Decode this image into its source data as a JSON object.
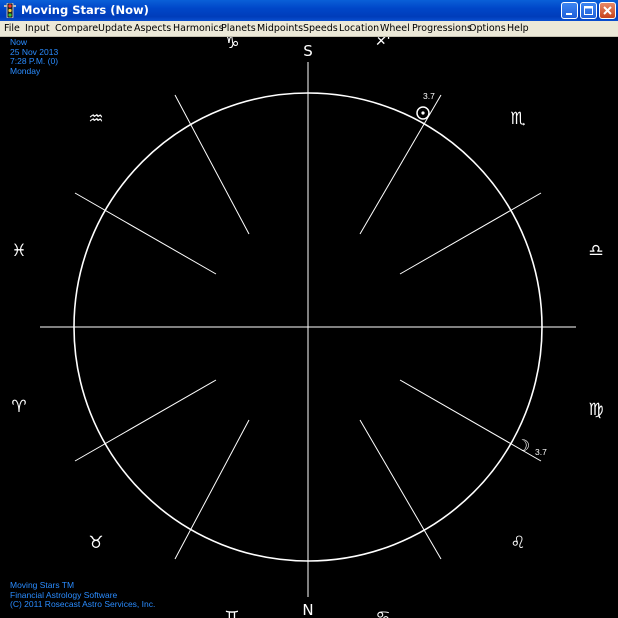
{
  "window": {
    "title": "Moving Stars (Now)",
    "buttons": [
      "minimize",
      "maximize",
      "close"
    ]
  },
  "menu": [
    "File",
    "Input",
    "Compare",
    "Update",
    "Aspects",
    "Harmonics",
    "Planets",
    "Midpoints",
    "Speeds",
    "Location",
    "Wheel",
    "Progressions",
    "Options",
    "Help"
  ],
  "chart_info": {
    "line1": "Now",
    "line2": "25 Nov 2013",
    "line3": "7:28 P.M. (0)",
    "line4": "Monday"
  },
  "footer": {
    "line1": "Moving Stars TM",
    "line2": "Financial Astrology Software",
    "line3": "(C) 2011 Rosecast Astro Services, Inc."
  },
  "wheel": {
    "south_label": "S",
    "north_label": "N",
    "signs": {
      "capricorn": "♑",
      "sagittarius": "♐",
      "aquarius": "♒",
      "scorpio": "♏",
      "pisces": "♓",
      "libra": "♎",
      "aries": "♈",
      "virgo": "♍",
      "taurus": "♉",
      "leo": "♌",
      "gemini": "♊",
      "cancer": "♋"
    },
    "planets": {
      "sun": {
        "glyph": "☉",
        "degree": "3.7"
      },
      "moon": {
        "glyph": "☽",
        "degree": "3.7"
      }
    }
  },
  "colors": {
    "background": "#000000",
    "wheel": "#ffffff",
    "info_text": "#2a8cff",
    "menubar": "#ece9d8",
    "titlebar": "#0046c8"
  }
}
